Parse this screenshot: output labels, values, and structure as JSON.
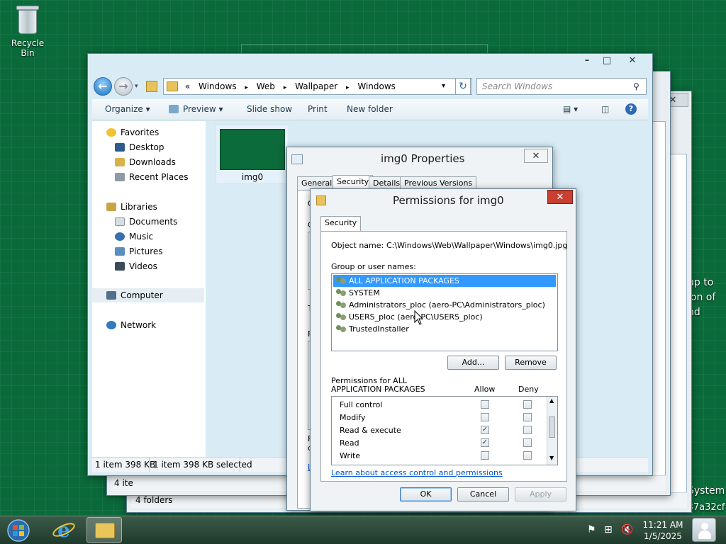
{
  "desktop": {
    "recycle_bin": "Recycle Bin",
    "behind_text": [
      "up to",
      "ion of",
      "nd"
    ],
    "behind_status": [
      "System",
      "f37a32cf"
    ]
  },
  "explorer": {
    "address_crumbs": [
      "«",
      "Windows",
      "▸",
      "Web",
      "▸",
      "Wallpaper",
      "▸",
      "Windows"
    ],
    "search_placeholder": "Search Windows",
    "toolbar": {
      "organize": "Organize",
      "preview": "Preview",
      "slide_show": "Slide show",
      "print": "Print",
      "new_folder": "New folder"
    },
    "nav": {
      "favorites": "Favorites",
      "desktop": "Desktop",
      "downloads": "Downloads",
      "recent_places": "Recent Places",
      "libraries": "Libraries",
      "documents": "Documents",
      "music": "Music",
      "pictures": "Pictures",
      "videos": "Videos",
      "computer": "Computer",
      "network": "Network"
    },
    "file_name": "img0",
    "status_items": "1 item 398 KB",
    "status_selected": "1 item 398 KB selected"
  },
  "back_windows": {
    "status_a": "4 ite",
    "status_b": "4 folders"
  },
  "properties": {
    "title": "img0 Properties",
    "tabs": [
      "General",
      "Security",
      "Details",
      "Previous Versions"
    ],
    "partial_labels": [
      "Gr",
      "To",
      "Re",
      "Fo",
      "cl",
      "Le"
    ]
  },
  "permissions": {
    "title": "Permissions for img0",
    "tab": "Security",
    "object_name_label": "Object name:",
    "object_name_value": "C:\\Windows\\Web\\Wallpaper\\Windows\\img0.jpg",
    "group_label": "Group or user names:",
    "users": [
      "ALL APPLICATION PACKAGES",
      "SYSTEM",
      "Administrators_ploc (aero-PC\\Administrators_ploc)",
      "USERS_ploc (aero-PC\\USERS_ploc)",
      "TrustedInstaller"
    ],
    "add_button": "Add...",
    "remove_button": "Remove",
    "perms_label_line1": "Permissions for ALL",
    "perms_label_line2": "APPLICATION PACKAGES",
    "allow_header": "Allow",
    "deny_header": "Deny",
    "perm_rows": [
      {
        "name": "Full control",
        "allow": false,
        "deny": false
      },
      {
        "name": "Modify",
        "allow": false,
        "deny": false
      },
      {
        "name": "Read & execute",
        "allow": true,
        "deny": false
      },
      {
        "name": "Read",
        "allow": true,
        "deny": false
      },
      {
        "name": "Write",
        "allow": false,
        "deny": false
      }
    ],
    "learn_link": "Learn about access control and permissions",
    "ok_button": "OK",
    "cancel_button": "Cancel",
    "apply_button": "Apply"
  },
  "taskbar": {
    "time": "11:21 AM",
    "date": "1/5/2025"
  }
}
